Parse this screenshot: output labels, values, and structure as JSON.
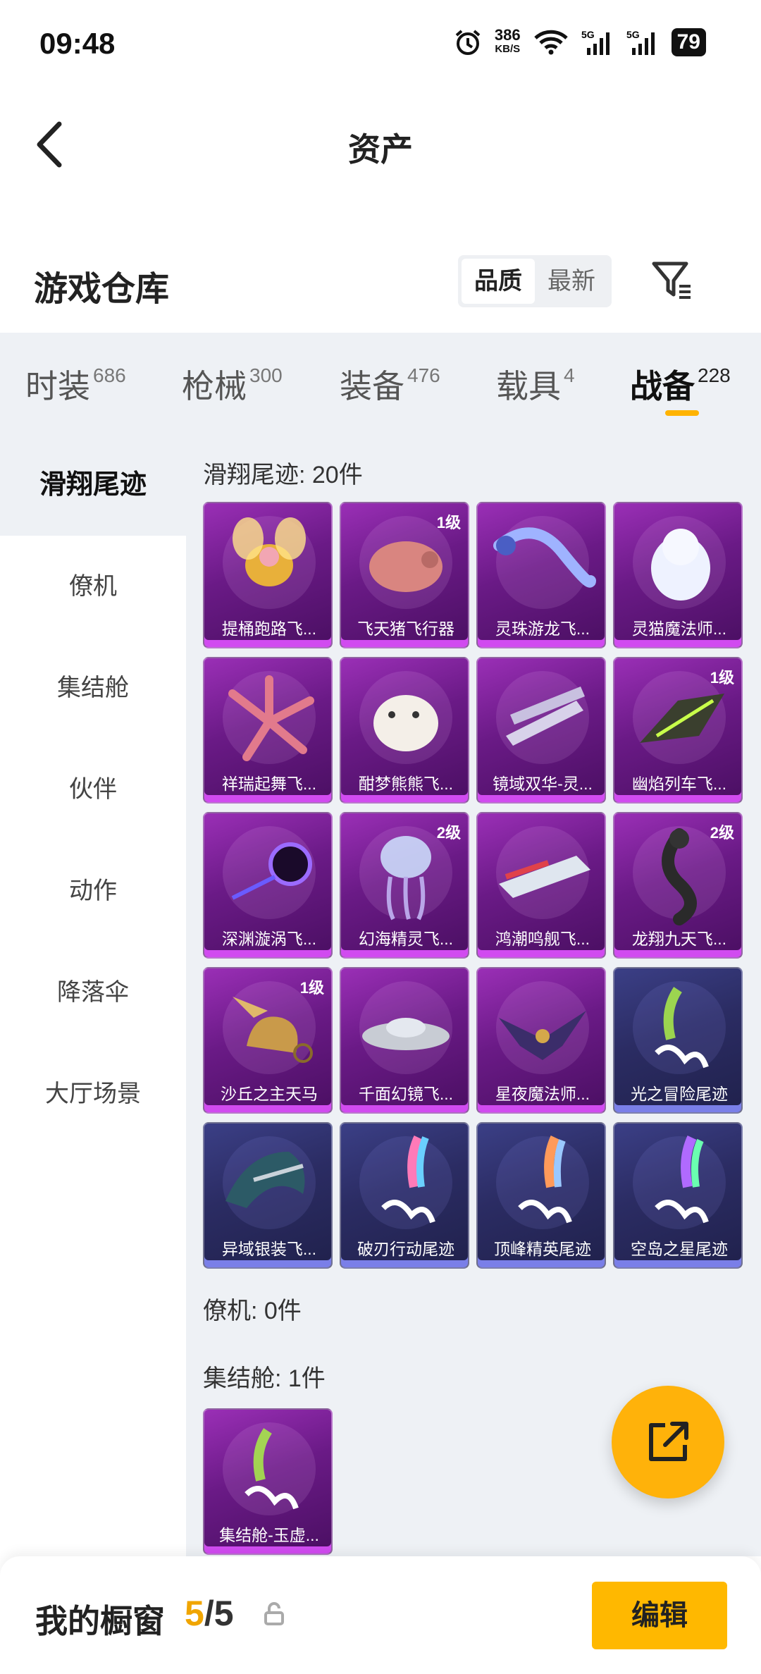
{
  "status_bar": {
    "time": "09:48",
    "net_speed": "386",
    "net_unit": "KB/S",
    "battery": "79"
  },
  "header": {
    "title": "资产"
  },
  "warehouse": {
    "title": "游戏仓库",
    "sort_options": [
      "品质",
      "最新"
    ]
  },
  "tabs": [
    {
      "label": "时装",
      "count": "686"
    },
    {
      "label": "枪械",
      "count": "300"
    },
    {
      "label": "装备",
      "count": "476"
    },
    {
      "label": "载具",
      "count": "4"
    },
    {
      "label": "战备",
      "count": "228"
    }
  ],
  "sidebar": {
    "items": [
      "滑翔尾迹",
      "僚机",
      "集结舱",
      "伙伴",
      "动作",
      "降落伞",
      "大厅场景"
    ]
  },
  "sections": [
    {
      "title": "滑翔尾迹: 20件"
    },
    {
      "title": "僚机: 0件"
    },
    {
      "title": "集结舱: 1件"
    }
  ],
  "glide_items": [
    {
      "name": "提桶跑路飞...",
      "level": "",
      "tier": "purple",
      "icon": "bee-glider-icon"
    },
    {
      "name": "飞天猪飞行器",
      "level": "1级",
      "tier": "purple",
      "icon": "pig-glider-icon"
    },
    {
      "name": "灵珠游龙飞...",
      "level": "",
      "tier": "purple",
      "icon": "dragon-glider-icon"
    },
    {
      "name": "灵猫魔法师...",
      "level": "",
      "tier": "purple",
      "icon": "cat-glider-icon"
    },
    {
      "name": "祥瑞起舞飞...",
      "level": "",
      "tier": "purple",
      "icon": "starfish-glider-icon"
    },
    {
      "name": "酣梦熊熊飞...",
      "level": "",
      "tier": "purple",
      "icon": "bear-glider-icon"
    },
    {
      "name": "镜域双华-灵...",
      "level": "",
      "tier": "purple",
      "icon": "crystal-glider-icon"
    },
    {
      "name": "幽焰列车飞...",
      "level": "1级",
      "tier": "purple",
      "icon": "train-glider-icon"
    },
    {
      "name": "深渊漩涡飞...",
      "level": "",
      "tier": "purple",
      "icon": "vortex-glider-icon"
    },
    {
      "name": "幻海精灵飞...",
      "level": "2级",
      "tier": "purple",
      "icon": "jellyfish-glider-icon"
    },
    {
      "name": "鸿潮鸣舰飞...",
      "level": "",
      "tier": "purple",
      "icon": "ship-glider-icon"
    },
    {
      "name": "龙翔九天飞...",
      "level": "2级",
      "tier": "purple",
      "icon": "black-dragon-glider-icon"
    },
    {
      "name": "沙丘之主天马",
      "level": "1级",
      "tier": "purple",
      "icon": "pegasus-glider-icon"
    },
    {
      "name": "千面幻镜飞...",
      "level": "",
      "tier": "purple",
      "icon": "ufo-glider-icon"
    },
    {
      "name": "星夜魔法师...",
      "level": "",
      "tier": "purple",
      "icon": "crow-glider-icon"
    },
    {
      "name": "光之冒险尾迹",
      "level": "",
      "tier": "blue",
      "icon": "green-trail-icon"
    },
    {
      "name": "异域银装飞...",
      "level": "",
      "tier": "blue",
      "icon": "silver-wing-glider-icon"
    },
    {
      "name": "破刃行动尾迹",
      "level": "",
      "tier": "blue",
      "icon": "rainbow-trail-icon"
    },
    {
      "name": "顶峰精英尾迹",
      "level": "",
      "tier": "blue",
      "icon": "smoke-trail-icon"
    },
    {
      "name": "空岛之星尾迹",
      "level": "",
      "tier": "blue",
      "icon": "prism-trail-icon"
    }
  ],
  "pod_items": [
    {
      "name": "集结舱-玉虚...",
      "level": "",
      "tier": "purple",
      "icon": "pod-figure-icon"
    }
  ],
  "showcase": {
    "title": "我的橱窗",
    "current": "5",
    "separator": "/",
    "total": "5",
    "edit_label": "编辑"
  },
  "colors": {
    "accent": "#ffb300",
    "purple_tier": "#8b2aa8",
    "blue_tier": "#2e3070"
  }
}
